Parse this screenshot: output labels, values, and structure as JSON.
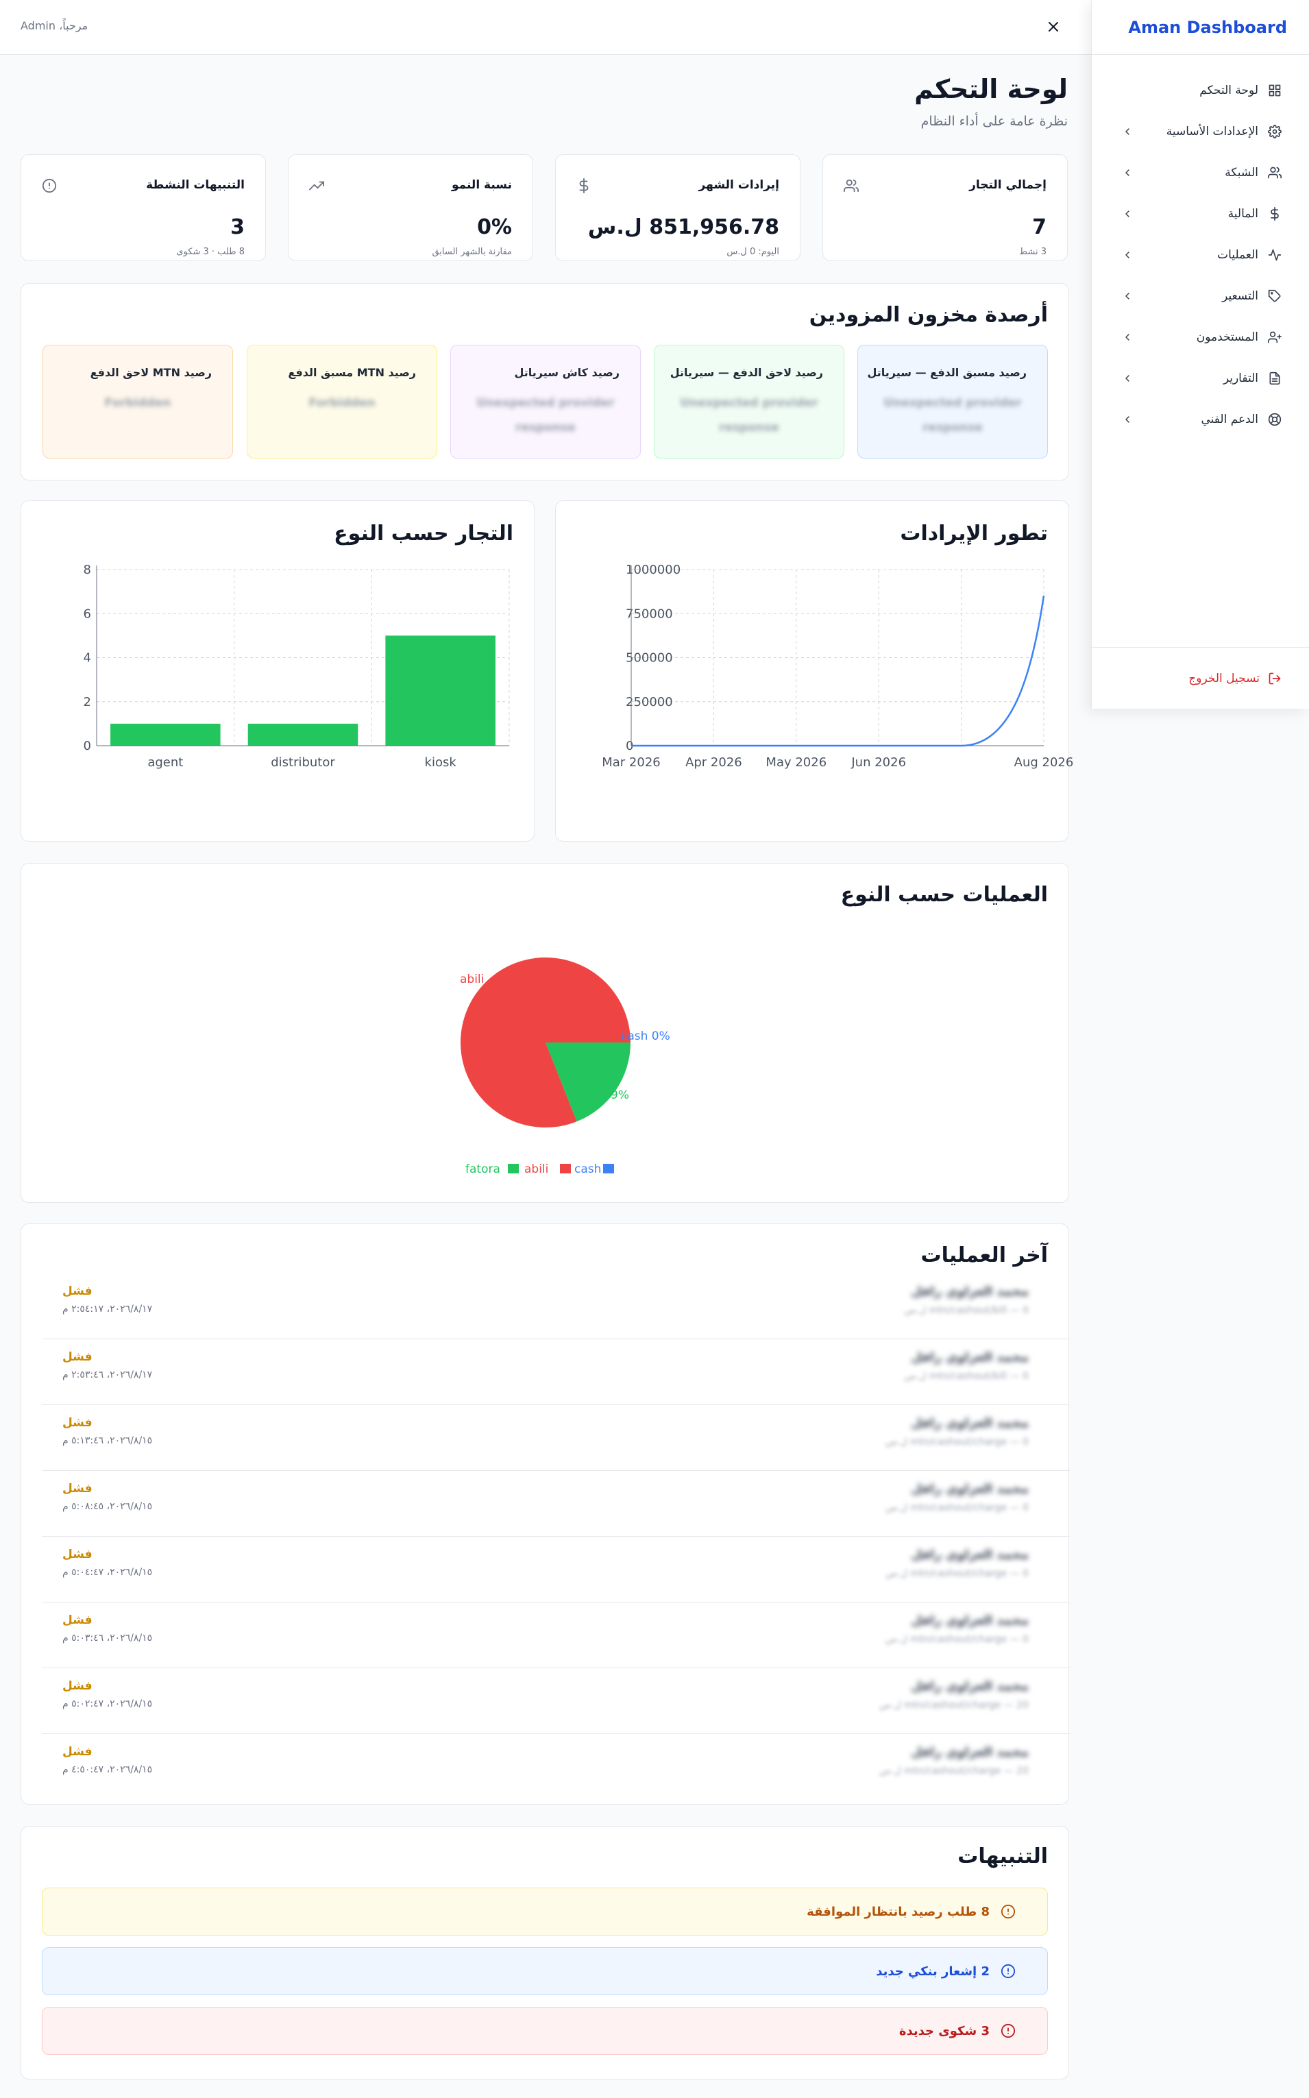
{
  "sidebar": {
    "brand": "Aman Dashboard",
    "items": [
      {
        "label": "لوحة التحكم",
        "icon": "grid-icon"
      },
      {
        "label": "الإعدادات الأساسية",
        "icon": "gear-icon"
      },
      {
        "label": "الشبكة",
        "icon": "users-icon"
      },
      {
        "label": "المالية",
        "icon": "dollar-icon"
      },
      {
        "label": "العمليات",
        "icon": "activity-icon"
      },
      {
        "label": "التسعير",
        "icon": "tag-icon"
      },
      {
        "label": "المستخدمون",
        "icon": "user-plus-icon"
      },
      {
        "label": "التقارير",
        "icon": "file-icon"
      },
      {
        "label": "الدعم الفني",
        "icon": "lifebuoy-icon"
      }
    ],
    "logout": "تسجيل الخروج"
  },
  "topbar": {
    "welcome": "مرحباً، Admin"
  },
  "page": {
    "title": "لوحة التحكم",
    "subtitle": "نظرة عامة على أداء النظام"
  },
  "stats": [
    {
      "title": "إجمالي التجار",
      "value": "7",
      "foot": "3 نشط",
      "icon": "users-icon"
    },
    {
      "title": "إيرادات الشهر",
      "value": "851,956.78 ل.س",
      "foot": "اليوم: 0 ل.س",
      "icon": "dollar-icon"
    },
    {
      "title": "نسبة النمو",
      "value": "0%",
      "foot": "مقارنة بالشهر السابق",
      "icon": "trending-up-icon"
    },
    {
      "title": "التنبيهات النشطة",
      "value": "3",
      "foot": "8 طلب · 3 شكوى",
      "icon": "alert-circle-icon"
    }
  ],
  "inventory": {
    "title": "أرصدة مخزون المزودين",
    "items": [
      {
        "title": "رصيد مسبق الدفع — سيرياتل",
        "value": "Unexpected provider response",
        "bg": "#eff6ff",
        "border": "#bfdbfe"
      },
      {
        "title": "رصيد لاحق الدفع — سيرياتل",
        "value": "Unexpected provider response",
        "bg": "#f0fdf4",
        "border": "#bbf7d0"
      },
      {
        "title": "رصيد كاش سيرياتل",
        "value": "Unexpected provider response",
        "bg": "#faf5ff",
        "border": "#e9d5ff"
      },
      {
        "title": "رصيد MTN مسبق الدفع",
        "value": "Forbidden",
        "bg": "#fefce8",
        "border": "#fef08a"
      },
      {
        "title": "رصيد MTN لاحق الدفع",
        "value": "Forbidden",
        "bg": "#fff7ed",
        "border": "#fed7aa"
      }
    ]
  },
  "revenue_chart": {
    "title": "تطور الإيرادات"
  },
  "merchants_chart": {
    "title": "التجار حسب النوع"
  },
  "ops_chart": {
    "title": "العمليات حسب النوع"
  },
  "chart_data": [
    {
      "type": "line",
      "x": [
        "Mar 2026",
        "Apr 2026",
        "May 2026",
        "Jun 2026",
        "Jul 2026",
        "Aug 2026"
      ],
      "x_ticks": [
        "Mar 2026",
        "Apr 2026",
        "May 2026",
        "Jun 2026",
        "Aug 2026"
      ],
      "values": [
        0,
        0,
        0,
        0,
        0,
        851956.78
      ],
      "y_ticks": [
        "0",
        "250000",
        "500000",
        "750000",
        "1000000"
      ],
      "ylim": [
        0,
        1000000
      ],
      "color": "#3b82f6",
      "grid": true
    },
    {
      "type": "bar",
      "categories": [
        "agent",
        "distributor",
        "kiosk"
      ],
      "values": [
        1,
        1,
        5
      ],
      "y_ticks": [
        "0",
        "2",
        "4",
        "6",
        "8"
      ],
      "ylim": [
        0,
        8
      ],
      "color": "#22c55e",
      "grid": true
    },
    {
      "type": "pie",
      "slices": [
        {
          "name": "fatora",
          "value": 19,
          "color": "#22c55e",
          "label": "9%"
        },
        {
          "name": "abili",
          "value": 81,
          "color": "#ef4444",
          "label": "abili"
        },
        {
          "name": "cash",
          "value": 0,
          "color": "#3b82f6",
          "label": "cash 0%"
        }
      ],
      "legend_position": "bottom"
    }
  ],
  "transactions": {
    "title": "آخر العمليات",
    "rows": [
      {
        "name": "محمد العزاوي رافل",
        "meta": "0 — mtn/cashout/bill ل.س",
        "status": "فشل",
        "date": "٢٠٢٦/٨/١٧، ٢:٥٤:١٧ م"
      },
      {
        "name": "محمد العزاوي رافل",
        "meta": "0 — mtn/cashout/bill ل.س",
        "status": "فشل",
        "date": "٢٠٢٦/٨/١٧، ٢:٥٣:٤٦ م"
      },
      {
        "name": "محمد العزاوي رافل",
        "meta": "0 — mtn/cashout/charge ل.س",
        "status": "فشل",
        "date": "٢٠٢٦/٨/١٥، ٥:١٣:٤٦ م"
      },
      {
        "name": "محمد العزاوي رافل",
        "meta": "0 — mtn/cashout/charge ل.س",
        "status": "فشل",
        "date": "٢٠٢٦/٨/١٥، ٥:٠٨:٤٥ م"
      },
      {
        "name": "محمد العزاوي رافل",
        "meta": "0 — mtn/cashout/charge ل.س",
        "status": "فشل",
        "date": "٢٠٢٦/٨/١٥، ٥:٠٤:٤٧ م"
      },
      {
        "name": "محمد العزاوي رافل",
        "meta": "0 — mtn/cashout/charge ل.س",
        "status": "فشل",
        "date": "٢٠٢٦/٨/١٥، ٥:٠٣:٤٦ م"
      },
      {
        "name": "محمد العزاوي رافل",
        "meta": "20 — mtn/cashout/charge ل.س",
        "status": "فشل",
        "date": "٢٠٢٦/٨/١٥، ٥:٠٢:٤٧ م"
      },
      {
        "name": "محمد العزاوي رافل",
        "meta": "20 — mtn/cashout/charge ل.س",
        "status": "فشل",
        "date": "٢٠٢٦/٨/١٥، ٤:٥٠:٤٧ م"
      }
    ]
  },
  "alerts": {
    "title": "التنبيهات",
    "items": [
      {
        "text": "8 طلب رصيد بانتظار الموافقة",
        "bg": "#fefce8",
        "border": "#fde68a",
        "color": "#b45309"
      },
      {
        "text": "2 إشعار بنكي جديد",
        "bg": "#eff6ff",
        "border": "#bfdbfe",
        "color": "#1d4ed8"
      },
      {
        "text": "3 شكوى جديدة",
        "bg": "#fef2f2",
        "border": "#fecaca",
        "color": "#b91c1c"
      }
    ]
  }
}
